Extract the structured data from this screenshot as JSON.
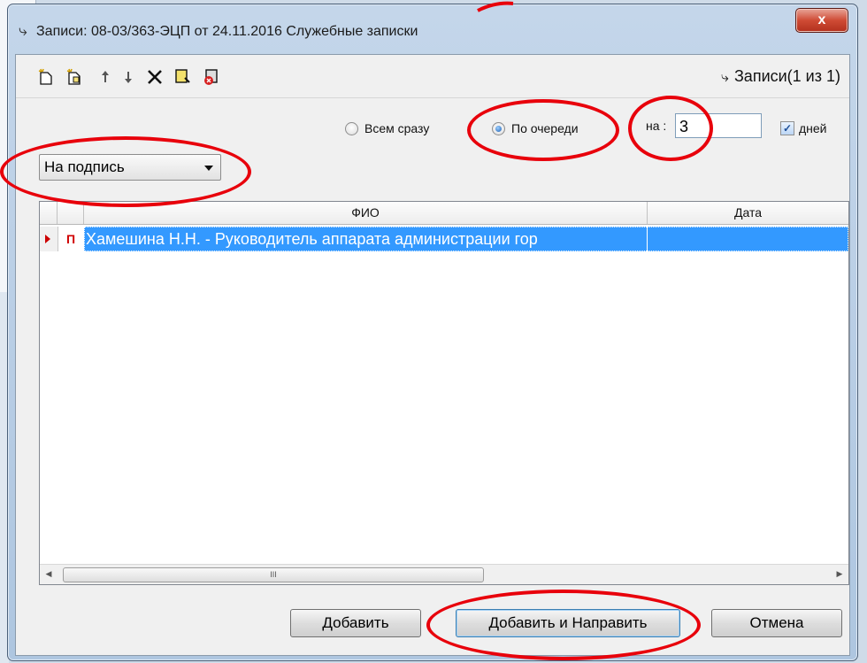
{
  "window": {
    "title": "Записи: 08-03/363-ЭЦП от 24.11.2016 Служебные записки",
    "close_glyph": "x"
  },
  "toolbar": {
    "buttons": [
      "add-record-icon",
      "add-copy-icon",
      "arrow-up-icon",
      "arrow-down-icon",
      "delete-icon",
      "edit-icon",
      "remove-icon"
    ],
    "records_label": "Записи(1 из 1)",
    "records_icon_glyph": "⤷"
  },
  "distribution": {
    "all_at_once": "Всем сразу",
    "sequential": "По очереди",
    "selected": "sequential",
    "period_label": "на :",
    "period_value": "3",
    "days_label": "дней",
    "days_checked": true
  },
  "action_select": {
    "value": "На подпись"
  },
  "grid": {
    "columns": [
      "ФИО",
      "Дата"
    ],
    "rows": [
      {
        "type": "П",
        "fio": "Хамешина Н.Н. - Руководитель аппарата администрации гор",
        "date": ""
      }
    ],
    "scroll_thumb_glyph": "III"
  },
  "buttons": {
    "add": "Добавить",
    "add_and_send": "Добавить и Направить",
    "cancel": "Отмена"
  },
  "colors": {
    "selection": "#3399ff",
    "annotation": "#e8000b",
    "row_type": "#d00000"
  }
}
